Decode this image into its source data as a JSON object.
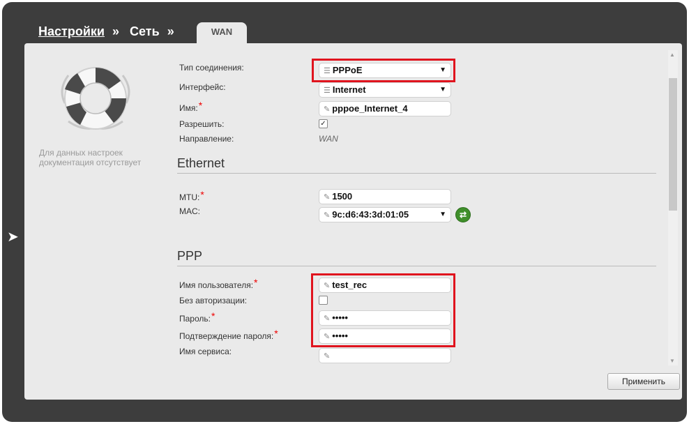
{
  "breadcrumb": {
    "settings": "Настройки",
    "network": "Сеть",
    "sep": "»"
  },
  "tab": {
    "label": "WAN"
  },
  "help": {
    "text": "Для данных настроек документация отсутствует"
  },
  "form": {
    "connection_type": {
      "label": "Тип соединения:",
      "value": "PPPoE"
    },
    "interface": {
      "label": "Интерфейс:",
      "value": "Internet"
    },
    "name": {
      "label": "Имя:",
      "value": "pppoe_Internet_4"
    },
    "enable": {
      "label": "Разрешить:",
      "checked": true
    },
    "direction": {
      "label": "Направление:",
      "value": "WAN"
    }
  },
  "ethernet": {
    "title": "Ethernet",
    "mtu": {
      "label": "MTU:",
      "value": "1500"
    },
    "mac": {
      "label": "MAC:",
      "value": "9c:d6:43:3d:01:05"
    }
  },
  "ppp": {
    "title": "PPP",
    "username": {
      "label": "Имя пользователя:",
      "value": "test_rec"
    },
    "no_auth": {
      "label": "Без авторизации:",
      "checked": false
    },
    "password": {
      "label": "Пароль:",
      "value": "•••••"
    },
    "password_confirm": {
      "label": "Подтверждение пароля:",
      "value": "•••••"
    },
    "service_name": {
      "label": "Имя сервиса:",
      "value": ""
    }
  },
  "required_mark": "*",
  "apply_button": "Применить",
  "colors": {
    "highlight": "#e0141e",
    "background": "#3d3d3d",
    "panel": "#eaeaea"
  },
  "icons": [
    "left-arrow-icon",
    "lifebuoy-icon",
    "list-icon",
    "pencil-icon",
    "dropdown-arrow-icon",
    "refresh-icon",
    "checkbox-icon"
  ]
}
